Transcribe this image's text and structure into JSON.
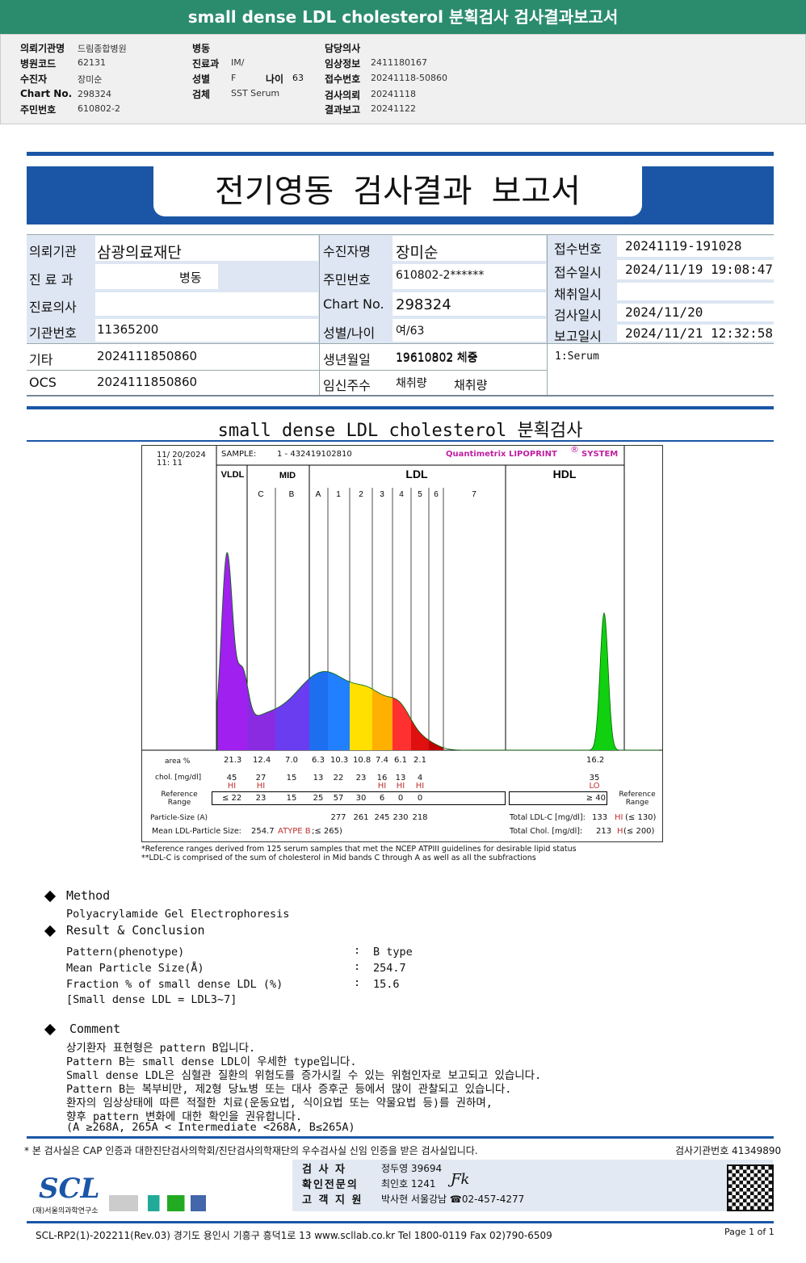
{
  "header": {
    "title": "small dense LDL cholesterol 분획검사 검사결과보고서"
  },
  "top": {
    "col1": [
      [
        "의뢰기관명",
        "드림종합병원"
      ],
      [
        "병원코드",
        "62131"
      ],
      [
        "수진자",
        "장미순"
      ],
      [
        "Chart No.",
        "298324"
      ],
      [
        "주민번호",
        "610802-2"
      ]
    ],
    "col2": [
      [
        "병동",
        ""
      ],
      [
        "진료과",
        "IM/"
      ],
      [
        "성별",
        "F"
      ],
      [
        "검체",
        "SST Serum"
      ]
    ],
    "age_label": "나이",
    "age": "63",
    "col3": [
      [
        "담당의사",
        ""
      ],
      [
        "임상정보",
        "2411180167"
      ],
      [
        "접수번호",
        "20241118-50860"
      ],
      [
        "검사의뢰",
        "20241118"
      ],
      [
        "결과보고",
        "20241122"
      ]
    ]
  },
  "report": {
    "title": "전기영동 검사결과 보고서",
    "rows": [
      {
        "l1": "의뢰기관",
        "v1": "삼광의료재단",
        "l2": "수진자명",
        "v2": "장미순"
      },
      {
        "l1": "진 료 과",
        "v1": "병동",
        "l2": "주민번호",
        "v2": "610802-2******"
      },
      {
        "l1": "진료의사",
        "v1": "",
        "l2": "Chart No.",
        "v2": "298324"
      },
      {
        "l1": "기관번호",
        "v1": "11365200",
        "l2": "성별/나이",
        "v2": "여/63"
      },
      {
        "l1": "기타",
        "v1": "2024111850860",
        "l2": "생년월일",
        "v2": "19610802 체중"
      },
      {
        "l1": "OCS",
        "v1": "2024111850860",
        "l2": "임신주수",
        "v2": "채취량"
      }
    ],
    "right": [
      [
        "접수번호",
        "20241119-191028"
      ],
      [
        "접수일시",
        "2024/11/19 19:08:47"
      ],
      [
        "채취일시",
        ""
      ],
      [
        "검사일시",
        "2024/11/20"
      ],
      [
        "보고일시",
        "2024/11/21 12:32:58"
      ]
    ],
    "specimen": "1:Serum"
  },
  "section_title": "small dense LDL cholesterol 분획검사",
  "chart_data": {
    "type": "area",
    "date": "11/ 20/2024",
    "time": "11: 11",
    "sample_label": "SAMPLE:",
    "sample": "1 - 432419102810",
    "brand": "Quantimetrix LIPOPRINT",
    "brand_mark": "®",
    "brand_suffix": "SYSTEM",
    "groups": [
      "VLDL",
      "MID",
      "LDL",
      "HDL"
    ],
    "bands": [
      "C",
      "B",
      "A",
      "1",
      "2",
      "3",
      "4",
      "5",
      "6",
      "7"
    ],
    "band_colors": [
      "#a020f0",
      "#8a2be2",
      "#6a3df0",
      "#1e6ef0",
      "#2080ff",
      "#ffe000",
      "#ffb000",
      "#ff3030",
      "#e01010",
      "#c00000",
      "#10d010"
    ],
    "row_labels": {
      "area": "area %",
      "chol": "chol. [mg/dl]",
      "ref": "Reference Range",
      "ref_r": "Reference Range",
      "size": "Particle-Size (A)",
      "mean": "Mean LDL-Particle Size:"
    },
    "area": [
      "21.3",
      "12.4",
      "7.0",
      "6.3",
      "10.3",
      "10.8",
      "7.4",
      "6.1",
      "2.1"
    ],
    "chol": [
      "45",
      "27",
      "15",
      "13",
      "22",
      "23",
      "16",
      "13",
      "4"
    ],
    "chol_flag": [
      "HI",
      "HI",
      "",
      "",
      "",
      "",
      "HI",
      "HI",
      "HI"
    ],
    "ref": [
      "≤ 22",
      "23",
      "15",
      "25",
      "57",
      "30",
      "6",
      "0",
      "0"
    ],
    "size": [
      "277",
      "261",
      "245",
      "230",
      "218"
    ],
    "hdl_area": "16.2",
    "hdl_chol": "35",
    "hdl_flag": "LO",
    "hdl_ref": "≥ 40",
    "mean_size": "254.7",
    "mean_type": "ATYPE B",
    "mean_ref": ";≤ 265)",
    "total_ldl_label": "Total LDL-C [mg/dl]:",
    "total_ldl": "133",
    "total_ldl_flag": "HI",
    "total_ldl_ref": "(≤ 130)",
    "total_chol_label": "Total Chol. [mg/dl]:",
    "total_chol": "213",
    "total_chol_flag": "H",
    "total_chol_ref": "(≤ 200)",
    "foot1": "*Reference ranges derived from 125 serum samples that met the NCEP ATPIII guidelines for desirable lipid status",
    "foot2": "**LDL-C is comprised of the sum of cholesterol in Mid bands C through A as well as all the subfractions"
  },
  "method": {
    "title": "Method",
    "text": "Polyacrylamide Gel Electrophoresis"
  },
  "result": {
    "title": "Result & Conclusion",
    "items": [
      [
        "Pattern(phenotype)",
        ":",
        "B type"
      ],
      [
        "Mean Particle Size(Å)",
        ":",
        "254.7"
      ],
      [
        "Fraction % of small dense LDL (%)",
        ":",
        "15.6"
      ]
    ],
    "note": "[Small dense LDL = LDL3~7]"
  },
  "comment": {
    "title": "Comment",
    "lines": [
      "상기환자 표현형은 pattern B입니다.",
      "Pattern B는 small dense LDL이 우세한 type입니다.",
      "Small dense LDL은 심혈관 질환의 위험도를 증가시킬 수 있는 위험인자로 보고되고 있습니다.",
      "Pattern B는 복부비만, 제2형 당뇨병 또는 대사 증후군 등에서 많이 관찰되고 있습니다.",
      "환자의 임상상태에 따른 적절한 치료(운동요법, 식이요법 또는 약물요법 등)를 권하며,",
      "향후 pattern 변화에 대한 확인을 권유합니다.",
      "(A ≥268A, 265A < Intermediate <268A, B≤265A)"
    ]
  },
  "footer": {
    "cert": "* 본 검사실은 CAP 인증과 대한진단검사의학회/진단검사의학재단의 우수검사실 신임 인증을 받은 검사실입니다.",
    "org_no": "검사기관번호 41349890",
    "staff": [
      [
        "검 사 자",
        "정두영 39694"
      ],
      [
        "확인전문의",
        "최인호 1241"
      ],
      [
        "고 객 지 원",
        "박사현 서울강남 ☎02-457-4277"
      ]
    ],
    "logo": "SCL",
    "logo_sub": "(재)서울의과학연구소",
    "address": "SCL-RP2(1)-202211(Rev.03) 경기도 용인시 기흥구 흥덕1로 13 www.scllab.co.kr Tel 1800-0119 Fax 02)790-6509",
    "page": "Page 1 of 1"
  }
}
